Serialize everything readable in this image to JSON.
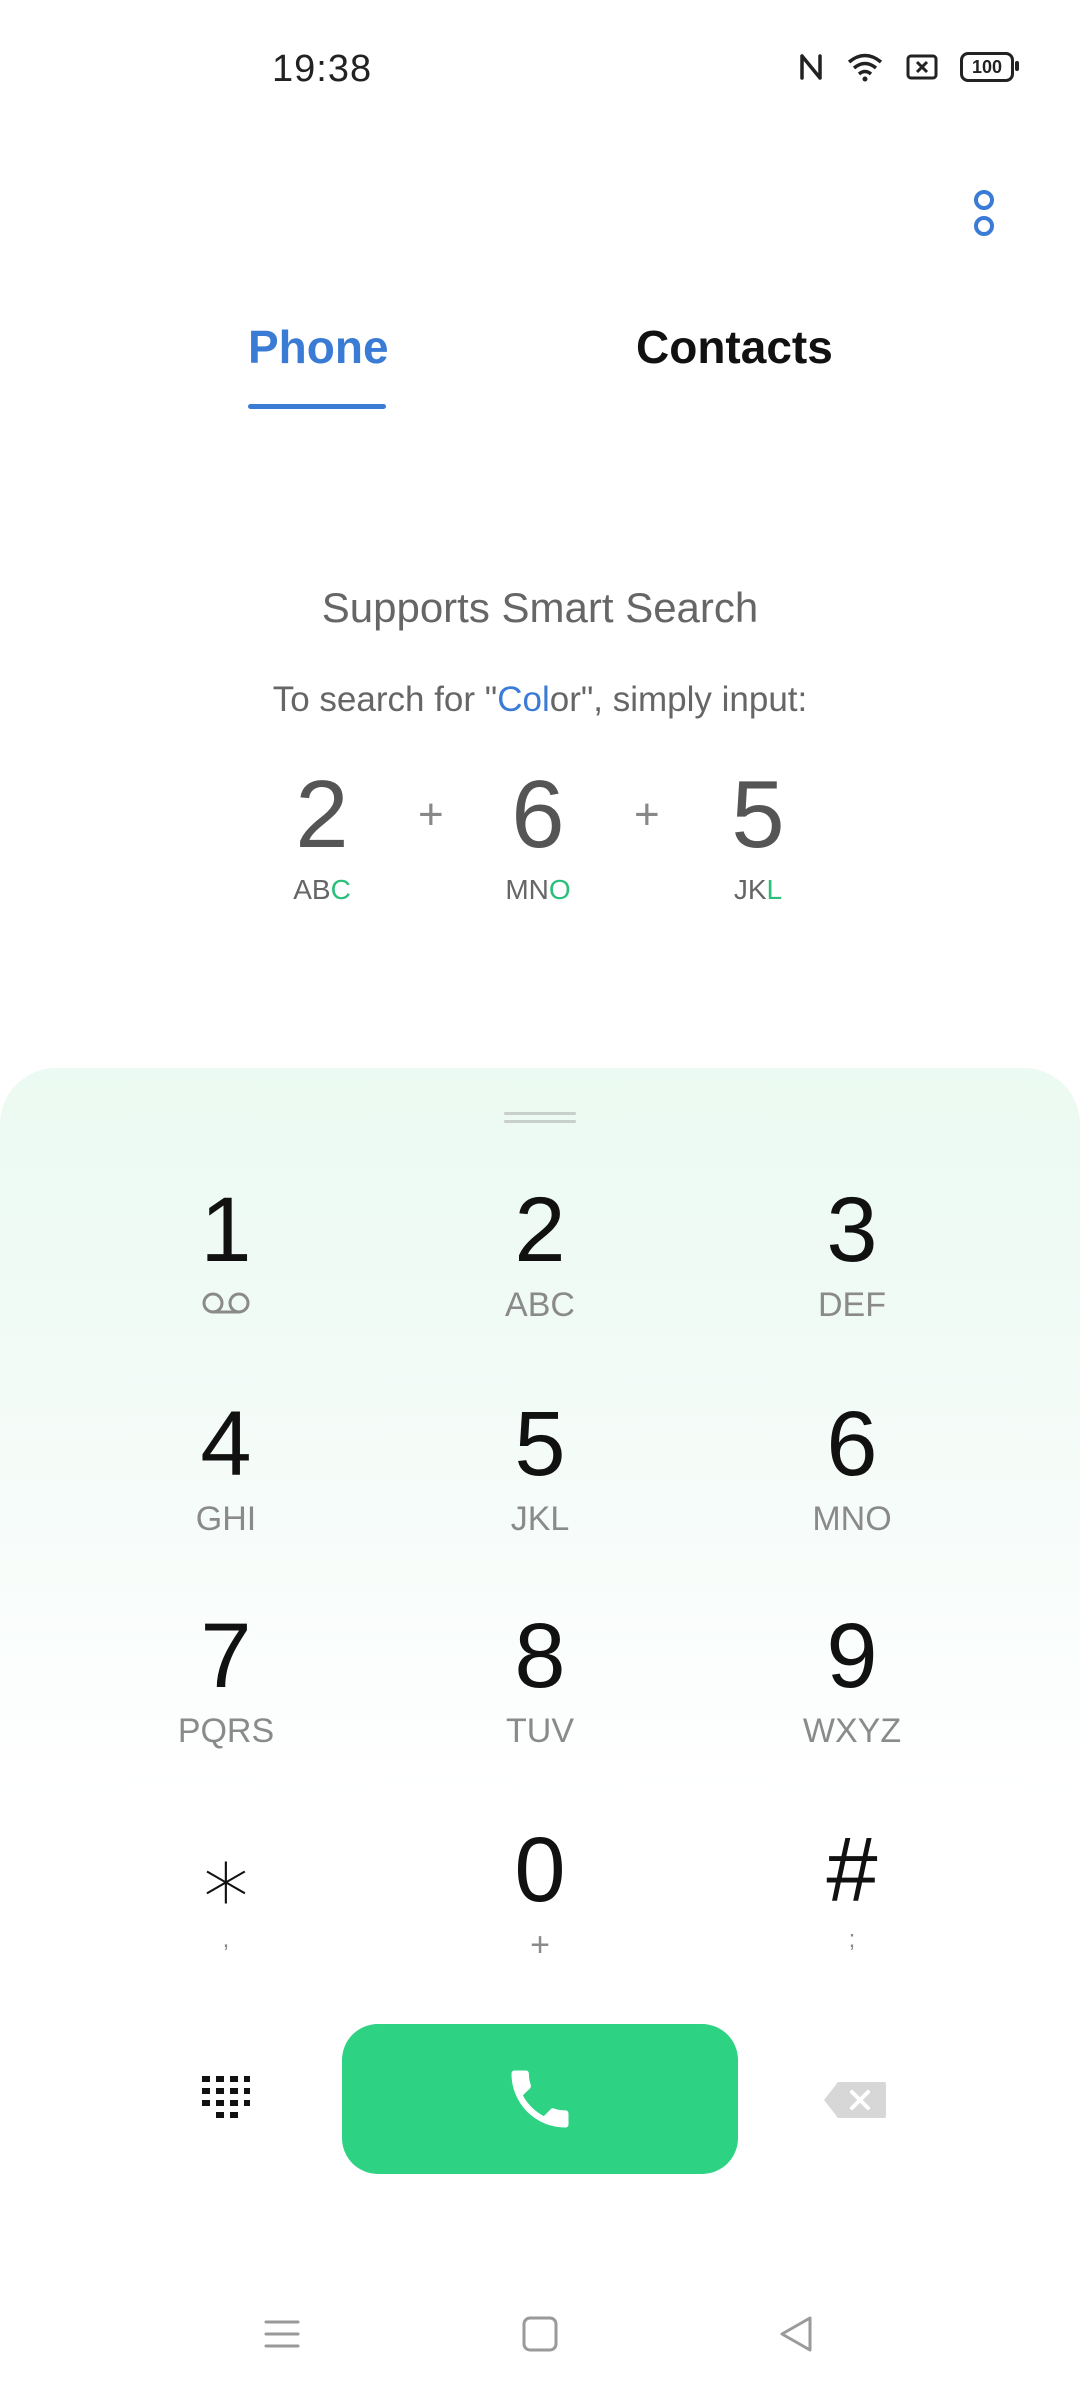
{
  "status_bar": {
    "time": "19:38",
    "battery": "100",
    "icons": [
      "nfc-icon",
      "wifi-icon",
      "sim-icon",
      "battery-icon"
    ]
  },
  "tabs": {
    "phone": "Phone",
    "contacts": "Contacts",
    "active": "phone"
  },
  "hint": {
    "title": "Supports Smart Search",
    "sub_prefix": "To search for \"",
    "sub_highlight": "Col",
    "sub_rest": "or",
    "sub_suffix": "\", simply input:",
    "digits": [
      {
        "num": "2",
        "letters_plain": "AB",
        "letters_hl": "C"
      },
      {
        "num": "6",
        "letters_plain": "MN",
        "letters_hl": "O"
      },
      {
        "num": "5",
        "letters_plain": "JK",
        "letters_hl": "L"
      }
    ],
    "plus": "+"
  },
  "keypad": [
    {
      "digit": "1",
      "letters": "",
      "icon": "voicemail-icon"
    },
    {
      "digit": "2",
      "letters": "ABC"
    },
    {
      "digit": "3",
      "letters": "DEF"
    },
    {
      "digit": "4",
      "letters": "GHI"
    },
    {
      "digit": "5",
      "letters": "JKL"
    },
    {
      "digit": "6",
      "letters": "MNO"
    },
    {
      "digit": "7",
      "letters": "PQRS"
    },
    {
      "digit": "8",
      "letters": "TUV"
    },
    {
      "digit": "9",
      "letters": "WXYZ"
    },
    {
      "digit": "⁎",
      "letters": ","
    },
    {
      "digit": "0",
      "letters": "+"
    },
    {
      "digit": "#",
      "letters": ";"
    }
  ],
  "colors": {
    "accent": "#3a7bd5",
    "call": "#2ed283",
    "highlight_green": "#2bbf7a"
  }
}
